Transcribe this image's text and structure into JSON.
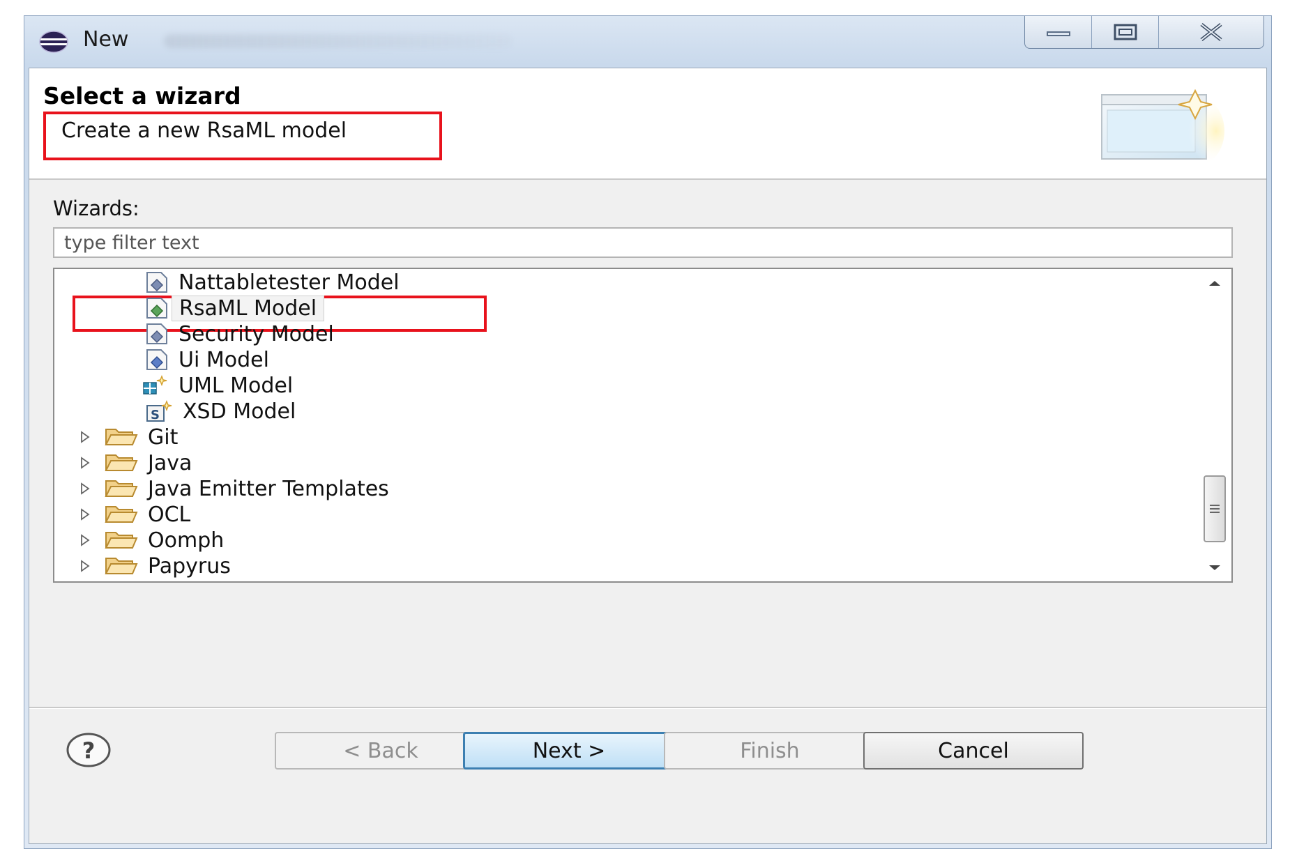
{
  "window": {
    "title": "New"
  },
  "header": {
    "title": "Select a wizard",
    "description": "Create a new RsaML model"
  },
  "wizards": {
    "label": "Wizards:",
    "filter_placeholder": "type filter text",
    "items": [
      {
        "label": "Nattabletester Model",
        "icon": "emf-model-icon",
        "selected": false
      },
      {
        "label": "RsaML Model",
        "icon": "emf-model-icon",
        "selected": true
      },
      {
        "label": "Security Model",
        "icon": "emf-model-icon",
        "selected": false
      },
      {
        "label": "Ui Model",
        "icon": "emf-model-icon",
        "selected": false
      },
      {
        "label": "UML Model",
        "icon": "uml-model-icon",
        "selected": false
      },
      {
        "label": "XSD Model",
        "icon": "xsd-model-icon",
        "selected": false
      }
    ],
    "folders": [
      {
        "label": "Git",
        "icon": "folder-icon",
        "expanded": false
      },
      {
        "label": "Java",
        "icon": "folder-icon",
        "expanded": false
      },
      {
        "label": "Java Emitter Templates",
        "icon": "folder-icon",
        "expanded": false
      },
      {
        "label": "OCL",
        "icon": "folder-icon",
        "expanded": false
      },
      {
        "label": "Oomph",
        "icon": "folder-icon",
        "expanded": false
      },
      {
        "label": "Papyrus",
        "icon": "folder-icon",
        "expanded": false
      }
    ]
  },
  "buttons": {
    "back": "< Back",
    "next": "Next >",
    "finish": "Finish",
    "cancel": "Cancel"
  },
  "colors": {
    "highlight": "#e8121c",
    "default_button_border": "#3c7fb1"
  }
}
